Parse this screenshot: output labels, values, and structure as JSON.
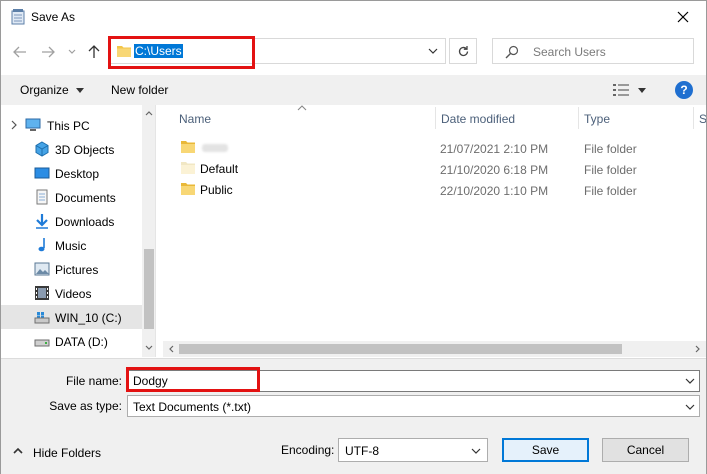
{
  "window": {
    "title": "Save As"
  },
  "address": {
    "path": "C:\\Users"
  },
  "search": {
    "placeholder": "Search Users"
  },
  "toolbar": {
    "organize_label": "Organize",
    "new_folder_label": "New folder"
  },
  "nav_pane": {
    "items": [
      {
        "label": "This PC",
        "icon": "this-pc-icon"
      },
      {
        "label": "3D Objects",
        "icon": "3d-objects-icon"
      },
      {
        "label": "Desktop",
        "icon": "desktop-icon"
      },
      {
        "label": "Documents",
        "icon": "documents-icon"
      },
      {
        "label": "Downloads",
        "icon": "downloads-icon"
      },
      {
        "label": "Music",
        "icon": "music-icon"
      },
      {
        "label": "Pictures",
        "icon": "pictures-icon"
      },
      {
        "label": "Videos",
        "icon": "videos-icon"
      },
      {
        "label": "WIN_10 (C:)",
        "icon": "drive-c-icon",
        "selected": true
      },
      {
        "label": "DATA (D:)",
        "icon": "drive-d-icon"
      }
    ]
  },
  "file_list": {
    "columns": [
      "Name",
      "Date modified",
      "Type",
      "S"
    ],
    "rows": [
      {
        "name": "",
        "date": "21/07/2021 2:10 PM",
        "type": "File folder"
      },
      {
        "name": "Default",
        "date": "21/10/2020 6:18 PM",
        "type": "File folder"
      },
      {
        "name": "Public",
        "date": "22/10/2020 1:10 PM",
        "type": "File folder"
      }
    ]
  },
  "form": {
    "file_name_label": "File name:",
    "file_name_value": "Dodgy",
    "save_type_label": "Save as type:",
    "save_type_value": "Text Documents (*.txt)",
    "encoding_label": "Encoding:",
    "encoding_value": "UTF-8"
  },
  "footer": {
    "hide_folders_label": "Hide Folders",
    "save_label": "Save",
    "cancel_label": "Cancel"
  },
  "colors": {
    "accent": "#0078d7",
    "highlight_box": "#e31212",
    "folder": "#f3c648"
  }
}
